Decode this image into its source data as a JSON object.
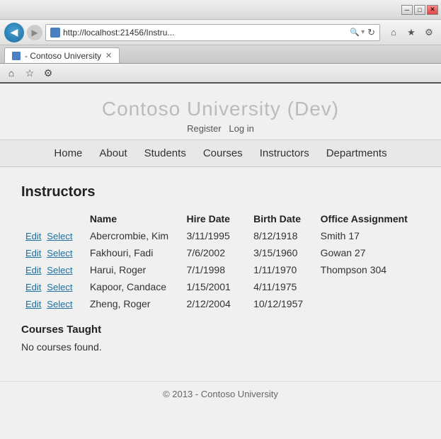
{
  "browser": {
    "title_bar_buttons": [
      "minimize",
      "maximize",
      "close"
    ],
    "minimize_symbol": "─",
    "maximize_symbol": "□",
    "close_symbol": "✕",
    "back_symbol": "◀",
    "forward_symbol": "▶",
    "address": "http://localhost:21456/Instru...",
    "tab_label": "- Contoso University",
    "tab_close": "✕",
    "home_icon": "⌂",
    "star_icon": "★",
    "gear_icon": "⚙",
    "search_icon": "🔍",
    "refresh_icon": "↻",
    "dropdown_icon": "▾"
  },
  "site": {
    "title": "Contoso University (Dev)",
    "auth": {
      "register": "Register",
      "login": "Log in"
    },
    "nav": [
      "Home",
      "About",
      "Students",
      "Courses",
      "Instructors",
      "Departments"
    ]
  },
  "page": {
    "heading": "Instructors",
    "table": {
      "columns": [
        "",
        "Name",
        "Hire Date",
        "Birth Date",
        "Office Assignment"
      ],
      "rows": [
        {
          "name": "Abercrombie, Kim",
          "hire_date": "3/11/1995",
          "birth_date": "8/12/1918",
          "office": "Smith 17"
        },
        {
          "name": "Fakhouri, Fadi",
          "hire_date": "7/6/2002",
          "birth_date": "3/15/1960",
          "office": "Gowan 27"
        },
        {
          "name": "Harui, Roger",
          "hire_date": "7/1/1998",
          "birth_date": "1/11/1970",
          "office": "Thompson 304"
        },
        {
          "name": "Kapoor, Candace",
          "hire_date": "1/15/2001",
          "birth_date": "4/11/1975",
          "office": ""
        },
        {
          "name": "Zheng, Roger",
          "hire_date": "2/12/2004",
          "birth_date": "10/12/1957",
          "office": ""
        }
      ],
      "edit_label": "Edit",
      "select_label": "Select"
    },
    "courses_section": {
      "heading": "Courses Taught",
      "no_courses": "No courses found."
    },
    "footer": "© 2013 - Contoso University"
  }
}
